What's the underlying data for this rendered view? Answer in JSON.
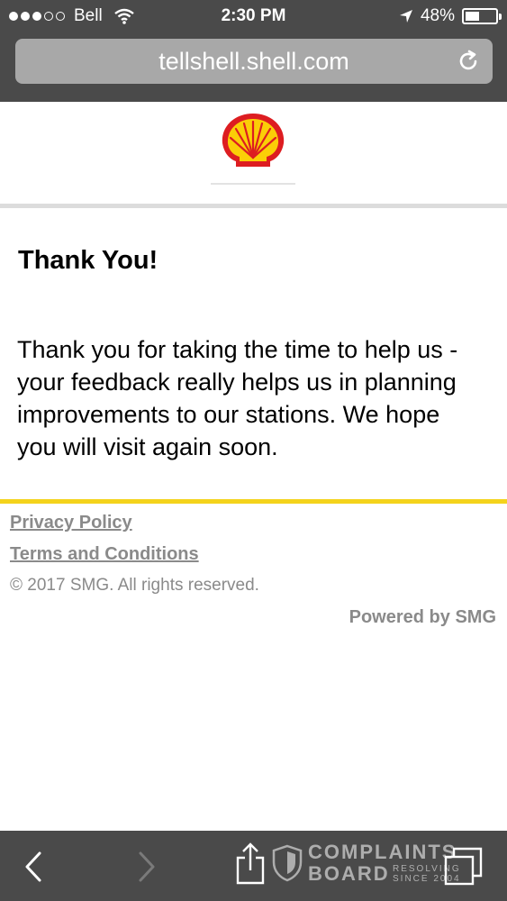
{
  "status_bar": {
    "carrier": "Bell",
    "time": "2:30 PM",
    "battery_text": "48%",
    "battery_level": 0.48,
    "signal_bars_filled": 3,
    "signal_bars_total": 5
  },
  "browser": {
    "url": "tellshell.shell.com"
  },
  "page": {
    "logo": "shell-pecten-logo",
    "heading": "Thank You!",
    "message": "Thank you for taking the time to help us - your feedback really helps us in planning improvements to our stations. We hope you will visit again soon.",
    "colors": {
      "accent_yellow": "#f4d31c",
      "shell_red": "#dd1d21",
      "footer_gray": "#8a8a8a"
    }
  },
  "footer": {
    "privacy_label": "Privacy Policy",
    "terms_label": "Terms and Conditions",
    "copyright": "© 2017 SMG. All rights reserved.",
    "powered_by": "Powered by SMG"
  },
  "watermark": {
    "line1": "COMPLAINTS",
    "line2": "BOARD",
    "tag1": "RESOLVING",
    "tag2": "SINCE 2004"
  }
}
